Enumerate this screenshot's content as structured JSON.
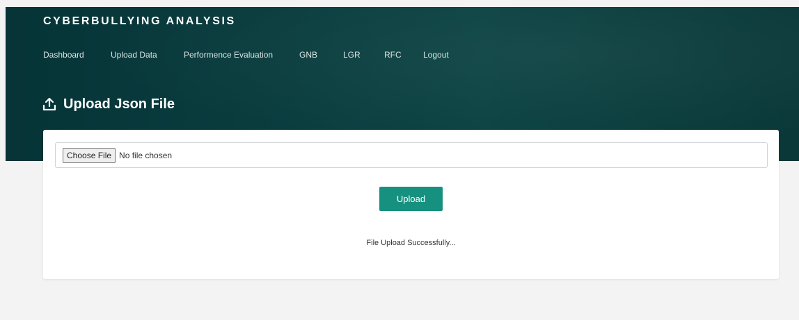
{
  "brand": "CYBERBULLYING ANALYSIS",
  "nav": {
    "items": [
      "Dashboard",
      "Upload Data",
      "Performence Evaluation",
      "GNB",
      "LGR",
      "RFC",
      "Logout"
    ]
  },
  "header": {
    "icon": "upload-icon",
    "title": "Upload Json File"
  },
  "form": {
    "choose_label": "Choose File",
    "file_status": "No file chosen",
    "upload_label": "Upload",
    "message": "File Upload Successfully..."
  },
  "colors": {
    "header_bg": "#0a3d3f",
    "accent": "#17917f",
    "page_bg": "#f3f3f3"
  }
}
